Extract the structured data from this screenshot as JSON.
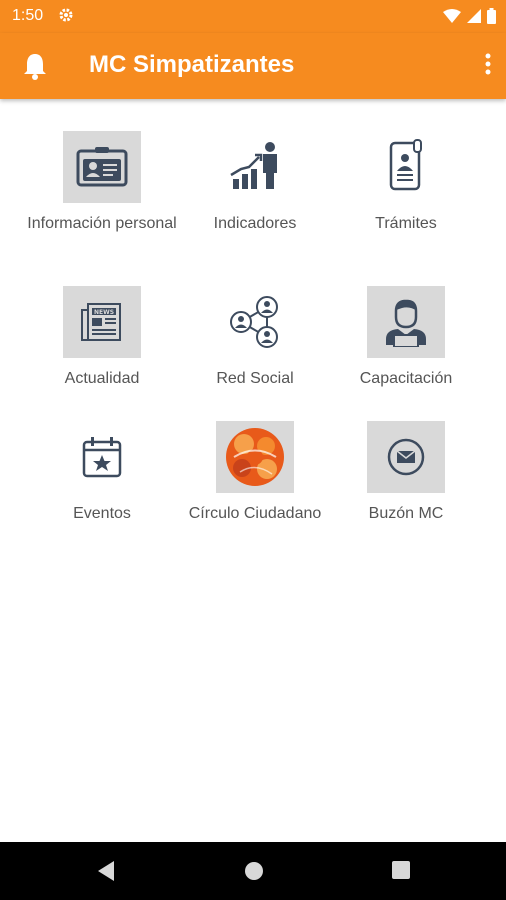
{
  "status_bar": {
    "time": "1:50",
    "icons": [
      "settings-gear-icon",
      "wifi-icon",
      "signal-icon",
      "battery-icon"
    ]
  },
  "app_bar": {
    "title": "MC Simpatizantes",
    "left_icon": "bell-icon",
    "right_icon": "more-vert-icon",
    "color": "#F68B1F"
  },
  "menu": {
    "items": [
      {
        "label": "Información personal",
        "icon": "id-card-icon"
      },
      {
        "label": "Indicadores",
        "icon": "chart-person-icon"
      },
      {
        "label": "Trámites",
        "icon": "phone-id-icon"
      },
      {
        "label": "Actualidad",
        "icon": "newspaper-icon"
      },
      {
        "label": "Red Social",
        "icon": "network-people-icon"
      },
      {
        "label": "Capacitación",
        "icon": "person-laptop-icon"
      },
      {
        "label": "Eventos",
        "icon": "calendar-star-icon"
      },
      {
        "label": "Círculo Ciudadano",
        "icon": "circle-logo-icon"
      },
      {
        "label": "Buzón MC",
        "icon": "mail-icon"
      }
    ]
  },
  "nav_bar": {
    "icons": [
      "back-icon",
      "home-icon",
      "recents-icon"
    ]
  }
}
